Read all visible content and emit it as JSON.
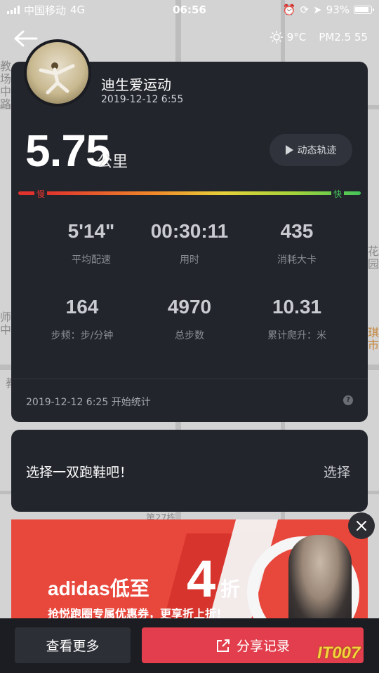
{
  "status_bar": {
    "carrier": "中国移动",
    "network": "4G",
    "time": "06:56",
    "battery": "93%"
  },
  "weather": {
    "temperature": "9°C",
    "pm25": "PM2.5 55"
  },
  "map_labels": [
    "教",
    "场",
    "中",
    "路",
    "师",
    "中",
    "教",
    "第27栋",
    "花园",
    "琪",
    "市"
  ],
  "user": {
    "name": "迪生爱运动",
    "datetime": "2019-12-12 6:55"
  },
  "summary": {
    "distance": "5.75",
    "distance_unit": "公里",
    "replay_label": "动态轨迹"
  },
  "speed_bar": {
    "slow_label": "慢",
    "fast_label": "快"
  },
  "stats": [
    {
      "value": "5'14\"",
      "label": "平均配速"
    },
    {
      "value": "00:30:11",
      "label": "用时"
    },
    {
      "value": "435",
      "label": "消耗大卡"
    },
    {
      "value": "164",
      "label": "步频：步/分钟"
    },
    {
      "value": "4970",
      "label": "总步数"
    },
    {
      "value": "10.31",
      "label": "累计爬升：米"
    }
  ],
  "start_time_text": "2019-12-12 6:25 开始统计",
  "help_label": "?",
  "shoe": {
    "prompt": "选择一双跑鞋吧！",
    "action": "选择"
  },
  "ad": {
    "brand_text": "adidas低至",
    "discount_number": "4",
    "discount_unit": "折",
    "subtitle": "抢悦跑圈专属优惠券，更享折上折！"
  },
  "bottom": {
    "more_label": "查看更多",
    "share_label": "分享记录"
  },
  "watermark": "IT007"
}
